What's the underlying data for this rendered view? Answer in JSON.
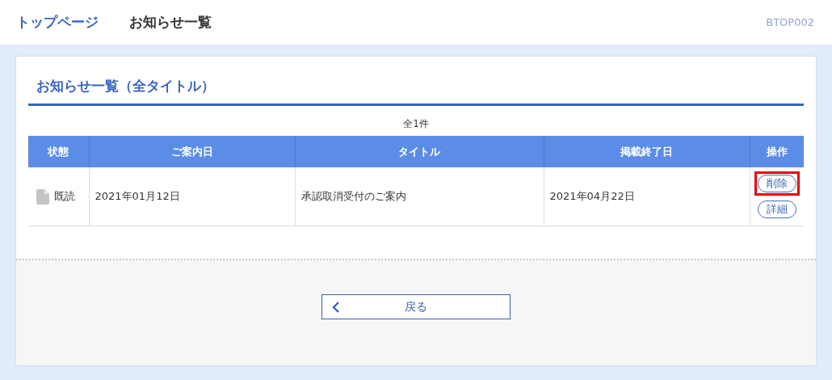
{
  "header": {
    "breadcrumb": [
      {
        "label": "トップページ",
        "kind": "link"
      },
      {
        "label": "お知らせ一覧",
        "kind": "current"
      }
    ],
    "screen_id": "BTOP002"
  },
  "section_title": "お知らせ一覧（全タイトル）",
  "count": "全1件",
  "table": {
    "columns": [
      "状態",
      "ご案内日",
      "タイトル",
      "掲載終了日",
      "操作"
    ],
    "rows": [
      {
        "status": "既読",
        "date": "2021年01月12日",
        "title": "承認取消受付のご案内",
        "end_date": "2021年04月22日",
        "actions": [
          {
            "label": "削除",
            "highlighted": true
          },
          {
            "label": "詳細",
            "highlighted": false
          }
        ]
      }
    ]
  },
  "back_button": "戻る"
}
